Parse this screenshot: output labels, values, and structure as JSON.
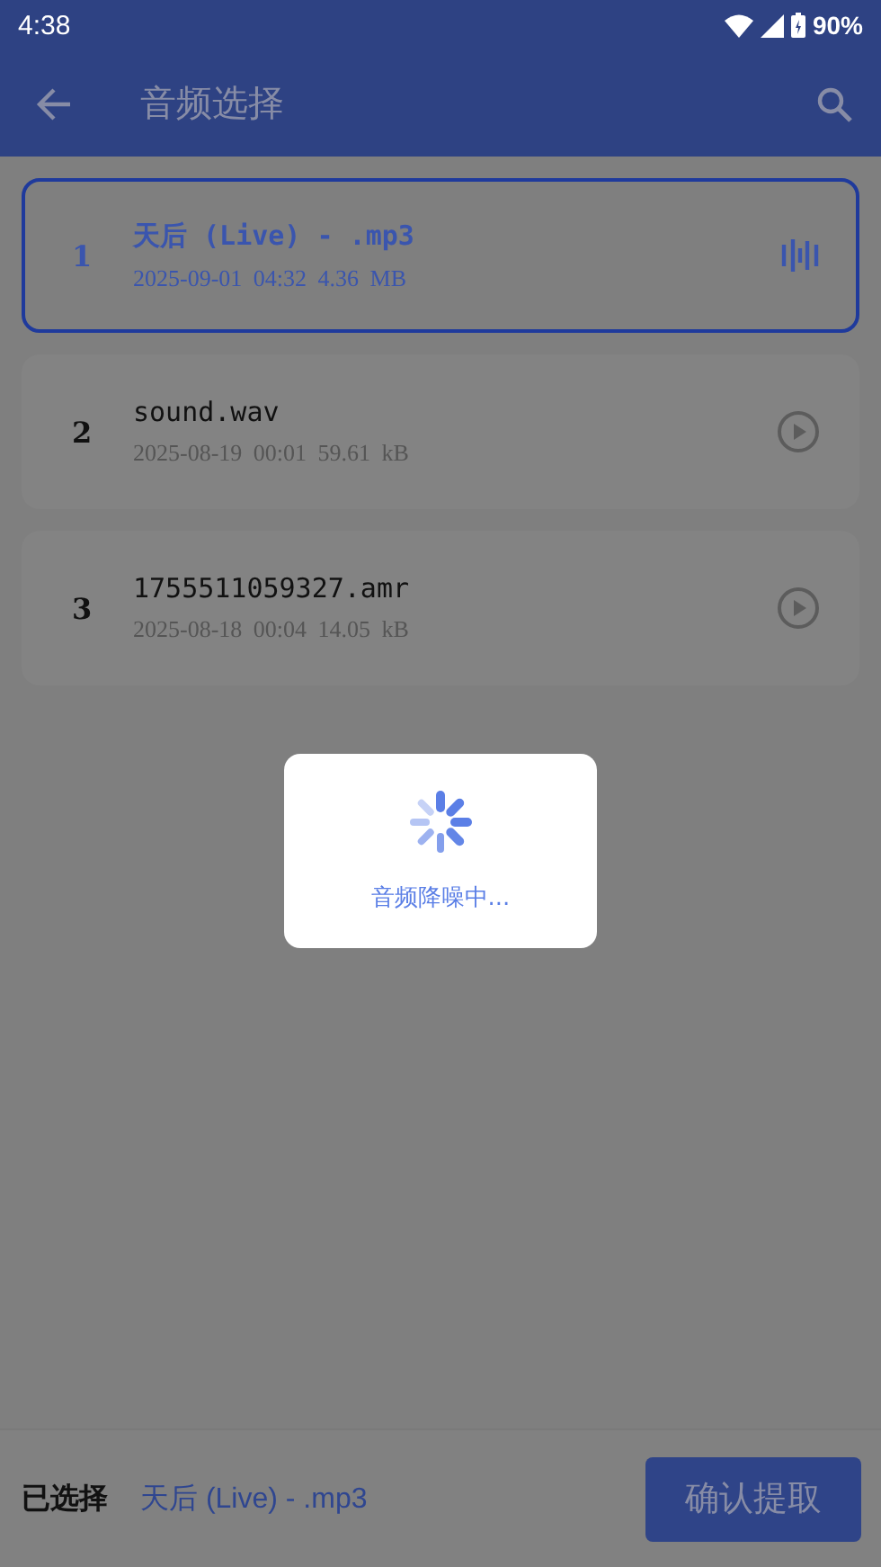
{
  "status_bar": {
    "time": "4:38",
    "battery": "90%"
  },
  "app_bar": {
    "title": "音频选择"
  },
  "files": [
    {
      "index": "1",
      "name": "天后 (Live) - .mp3",
      "meta": "2025-09-01 04:32 4.36 MB",
      "selected": true
    },
    {
      "index": "2",
      "name": "sound.wav",
      "meta": "2025-08-19 00:01 59.61 kB",
      "selected": false
    },
    {
      "index": "3",
      "name": "1755511059327.amr",
      "meta": "2025-08-18 00:04 14.05 kB",
      "selected": false
    }
  ],
  "loading": {
    "text": "音频降噪中..."
  },
  "footer": {
    "label": "已选择",
    "selected_name": "天后 (Live) - .mp3",
    "confirm_button": "确认提取"
  }
}
